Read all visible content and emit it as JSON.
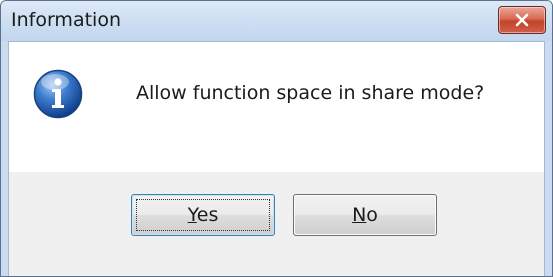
{
  "window": {
    "title": "Information",
    "close_icon": "close-x-icon",
    "close_color": "#c4432c"
  },
  "message": {
    "icon": "information-icon",
    "text": "Allow function space in share mode?"
  },
  "buttons": {
    "yes": {
      "mnemonic": "Y",
      "rest": "es",
      "is_default": true
    },
    "no": {
      "mnemonic": "N",
      "rest": "o",
      "is_default": false
    }
  }
}
